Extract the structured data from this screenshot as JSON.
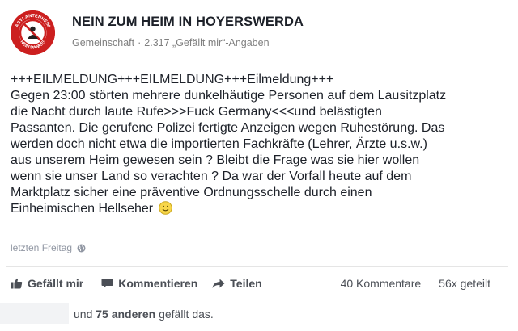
{
  "page": {
    "avatar_text_top": "ASYLANTENHEIM",
    "avatar_text_bottom": "NEIN DANKE!",
    "name": "NEIN ZUM HEIM IN HOYERSWERDA",
    "category": "Gemeinschaft",
    "likes_text": "2.317 „Gefällt mir“-Angaben"
  },
  "post": {
    "lines": [
      "+++EILMELDUNG+++EILMELDUNG+++Eilmeldung+++",
      "Gegen 23:00 störten mehrere dunkelhäutige Personen auf dem Lausitzplatz",
      "die Nacht durch laute Rufe>>>Fuck Germany<<<und belästigten",
      "Passanten. Die gerufene Polizei fertigte Anzeigen wegen Ruhestörung. Das",
      "werden doch nicht etwa die importierten Fachkräfte (Lehrer, Ärzte u.s.w.)",
      "aus unserem Heim gewesen sein ? Bleibt die Frage was sie hier wollen",
      "wenn sie unser Land so verachten ? Da war der Vorfall heute auf dem",
      "Marktplatz sicher eine präventive Ordnungsschelle durch einen",
      "Einheimischen Hellseher"
    ],
    "timestamp": "letzten Freitag"
  },
  "actions": {
    "like": "Gefällt mir",
    "comment": "Kommentieren",
    "share": "Teilen"
  },
  "stats": {
    "comments": "40 Kommentare",
    "shares": "56x geteilt"
  },
  "likers": {
    "prefix": "und",
    "count": "75 anderen",
    "suffix": "gefällt das."
  },
  "colors": {
    "avatar_red": "#cc1f1f",
    "text": "#1d2129",
    "meta_gray": "#7f7f7f",
    "action_gray": "#4b4f56"
  },
  "icons": {
    "avatar": "no-asylum-logo",
    "smiley": "smiley-emoji",
    "globe": "globe-icon",
    "like": "thumbs-up-icon",
    "comment": "speech-bubble-icon",
    "share": "share-arrow-icon"
  }
}
